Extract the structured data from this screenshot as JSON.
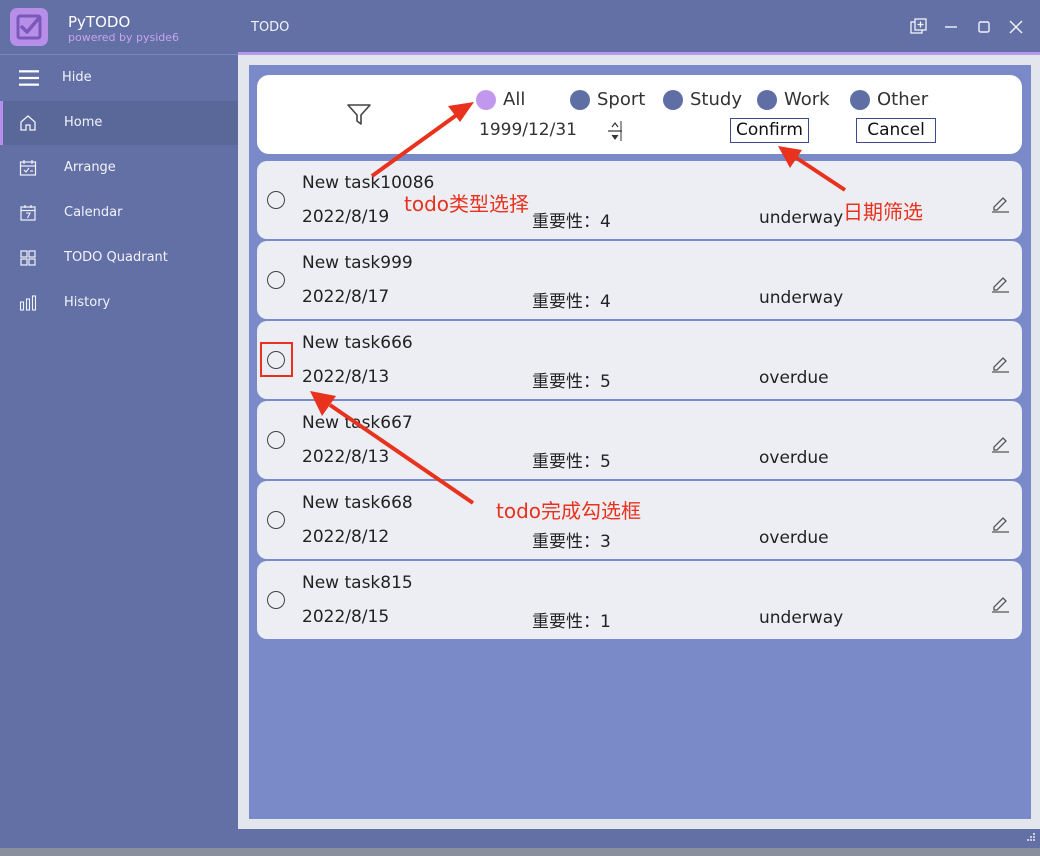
{
  "app": {
    "name": "PyTODO",
    "subtitle": "powered by pyside6",
    "window_title": "TODO",
    "accent_color": "#b78ee8",
    "sidebar_color": "#6270a5",
    "main_color": "#7a89c7"
  },
  "sidebar": {
    "hide_label": "Hide",
    "items": [
      {
        "label": "Home",
        "icon": "home-icon",
        "active": true
      },
      {
        "label": "Arrange",
        "icon": "arrange-icon",
        "active": false
      },
      {
        "label": "Calendar",
        "icon": "calendar-icon",
        "active": false
      },
      {
        "label": "TODO Quadrant",
        "icon": "quadrant-icon",
        "active": false
      },
      {
        "label": "History",
        "icon": "history-icon",
        "active": false
      }
    ]
  },
  "filter": {
    "categories": [
      {
        "label": "All",
        "checked": true
      },
      {
        "label": "Sport",
        "checked": false
      },
      {
        "label": "Study",
        "checked": false
      },
      {
        "label": "Work",
        "checked": false
      },
      {
        "label": "Other",
        "checked": false
      }
    ],
    "date": "1999/12/31",
    "confirm_label": "Confirm",
    "cancel_label": "Cancel"
  },
  "tasks": [
    {
      "name": "New task10086",
      "date": "2022/8/19",
      "importance_label": "重要性：",
      "importance": "4",
      "status": "underway"
    },
    {
      "name": "New task999",
      "date": "2022/8/17",
      "importance_label": "重要性：",
      "importance": "4",
      "status": "underway"
    },
    {
      "name": "New task666",
      "date": "2022/8/13",
      "importance_label": "重要性：",
      "importance": "5",
      "status": "overdue"
    },
    {
      "name": "New task667",
      "date": "2022/8/13",
      "importance_label": "重要性：",
      "importance": "5",
      "status": "overdue"
    },
    {
      "name": "New task668",
      "date": "2022/8/12",
      "importance_label": "重要性：",
      "importance": "3",
      "status": "overdue"
    },
    {
      "name": "New task815",
      "date": "2022/8/15",
      "importance_label": "重要性：",
      "importance": "1",
      "status": "underway"
    }
  ],
  "annotations": {
    "type_select": "todo类型选择",
    "date_filter": "日期筛选",
    "done_checkbox": "todo完成勾选框",
    "color": "#e8321e"
  }
}
